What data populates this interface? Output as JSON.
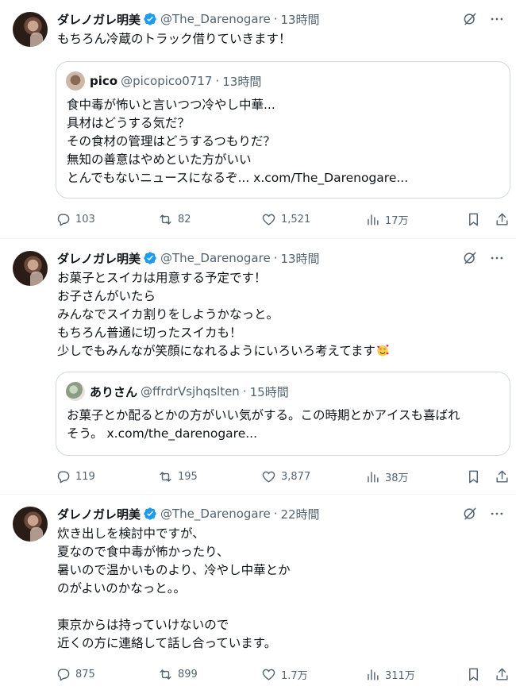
{
  "tweets": [
    {
      "name": "ダレノガレ明美",
      "handle": "@The_Darenogare",
      "time": "13時間",
      "text": "もちろん冷蔵のトラック借りていきます！",
      "quote": {
        "name": "pico",
        "handle": "@picopico0717",
        "time": "13時間",
        "text": "食中毒が怖いと言いつつ冷やし中華...\n具材はどうする気だ？\nその食材の管理はどうするつもりだ？\n無知の善意はやめといた方がいい\nとんでもないニュースになるぞ... x.com/The_Darenogare..."
      },
      "replies": "103",
      "retweets": "82",
      "likes": "1,521",
      "views": "17万"
    },
    {
      "name": "ダレノガレ明美",
      "handle": "@The_Darenogare",
      "time": "13時間",
      "text": "お菓子とスイカは用意する予定です！\nお子さんがいたら\nみんなでスイカ割りをしようかなっと。\nもちろん普通に切ったスイカも！\n少しでもみんなが笑顔になれるようにいろいろ考えてます",
      "emoji": "smiling-face-with-hearts",
      "quote": {
        "name": "ありさん",
        "handle": "@ffrdrVsjhqslten",
        "time": "15時間",
        "text": "お菓子とか配るとかの方がいい気がする。この時期とかアイスも喜ばれ\nそう。 x.com/the_darenogare..."
      },
      "replies": "119",
      "retweets": "195",
      "likes": "3,877",
      "views": "38万"
    },
    {
      "name": "ダレノガレ明美",
      "handle": "@The_Darenogare",
      "time": "22時間",
      "text": "炊き出しを検討中ですが、\n夏なので食中毒が怖かったり、\n暑いので温かいものより、冷やし中華とか\nのがよいのかなっと。。\n\n東京からは持っていけないので\n近くの方に連絡して話し合っています。",
      "replies": "875",
      "retweets": "899",
      "likes": "1.7万",
      "views": "311万"
    }
  ],
  "dot": "·",
  "icons": {
    "verified": "verified-badge-icon",
    "grok": "grok-icon",
    "more": "more-icon",
    "reply": "reply-icon",
    "retweet": "retweet-icon",
    "like": "heart-icon",
    "views": "views-icon",
    "bookmark": "bookmark-icon",
    "share": "share-icon"
  },
  "colors": {
    "verified": "#1d9bf0",
    "secondary_text": "#536471",
    "border": "#cfd9de"
  }
}
